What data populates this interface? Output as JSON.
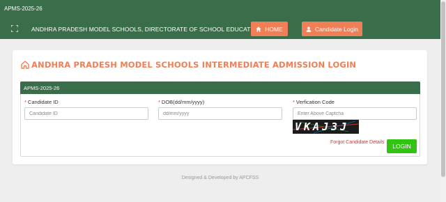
{
  "header": {
    "app_code": "APMS-2025-26",
    "title": "ANDHRA PRADESH MODEL SCHOOLS, DIRECTORATE OF SCHOOL EDUCATION.",
    "nav": {
      "home_label": "HOME",
      "candidate_login_label": "Candidate Login"
    }
  },
  "card": {
    "heading": "ANDHRA PRADESH MODEL SCHOOLS INTERMEDIATE ADMISSION LOGIN",
    "panel_title": "APMS-2025-26",
    "fields": {
      "candidate_id": {
        "label": "Candidate ID",
        "placeholder": "Candidate ID",
        "value": ""
      },
      "dob": {
        "label": "DOB(dd/mm/yyyy)",
        "placeholder": "dd/mm/yyyy",
        "value": ""
      },
      "captcha": {
        "label": "Verfication Code",
        "placeholder": "Enter Above Captcha",
        "value": ""
      }
    },
    "required_marker": "*",
    "captcha_text": "VKAJ3J",
    "forgot_label": "Forgot Candidate Details",
    "login_label": "LOGIN"
  },
  "footer": {
    "text": "Designed & Developed by APCFSS"
  },
  "colors": {
    "header_green": "#3a6e4b",
    "accent_orange": "#f07e56",
    "login_green": "#32c412",
    "required_red": "#d9302c"
  }
}
